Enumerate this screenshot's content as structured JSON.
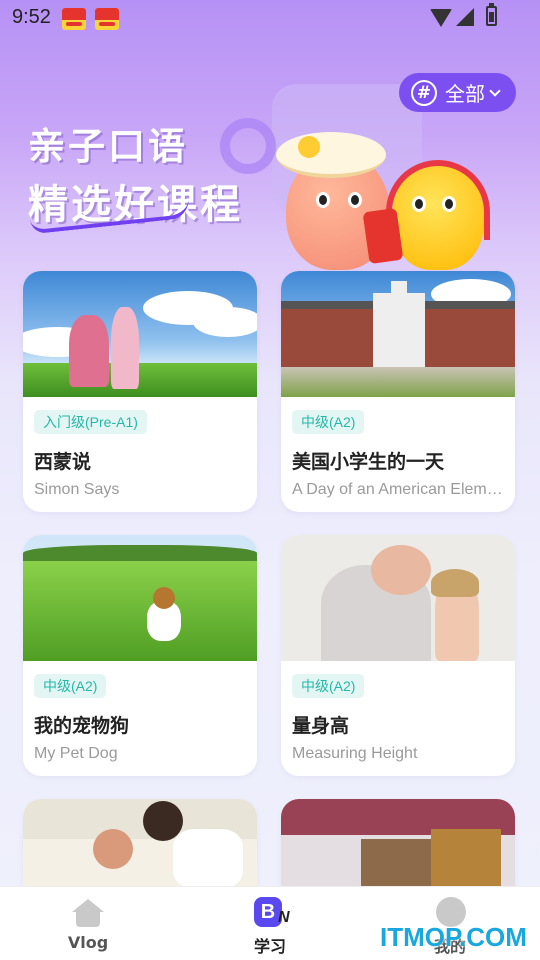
{
  "status_bar": {
    "time": "9:52",
    "app_icons": [
      "news-app-icon",
      "news-app-icon"
    ],
    "indicators": [
      "wifi-icon",
      "signal-icon",
      "battery-charging-icon"
    ]
  },
  "filter": {
    "icon": "hashtag-icon",
    "label": "全部"
  },
  "banner": {
    "line1": "亲子口语",
    "line2": "精选好课程"
  },
  "courses": [
    {
      "level": "入门级(Pre-A1)",
      "title_cn": "西蒙说",
      "title_en": "Simon Says"
    },
    {
      "level": "中级(A2)",
      "title_cn": "美国小学生的一天",
      "title_en": "A Day of an American Elementary Student"
    },
    {
      "level": "中级(A2)",
      "title_cn": "我的宠物狗",
      "title_en": "My Pet Dog"
    },
    {
      "level": "中级(A2)",
      "title_cn": "量身高",
      "title_en": "Measuring Height"
    },
    {
      "level": "",
      "title_cn": "",
      "title_en": ""
    },
    {
      "level": "",
      "title_cn": "",
      "title_en": ""
    }
  ],
  "bottom_nav": {
    "items": [
      {
        "label": "Vlog",
        "icon": "house-icon",
        "active": false
      },
      {
        "label": "学习",
        "icon": "study-icon",
        "active": true
      },
      {
        "label": "我的",
        "icon": "profile-icon",
        "active": false
      }
    ]
  },
  "watermark": "ITMOP.COM",
  "colors": {
    "accent_purple": "#7c4ff0",
    "level_badge_text": "#27b7a9",
    "level_badge_bg": "#e3f6f3",
    "watermark": "#19a7df"
  }
}
